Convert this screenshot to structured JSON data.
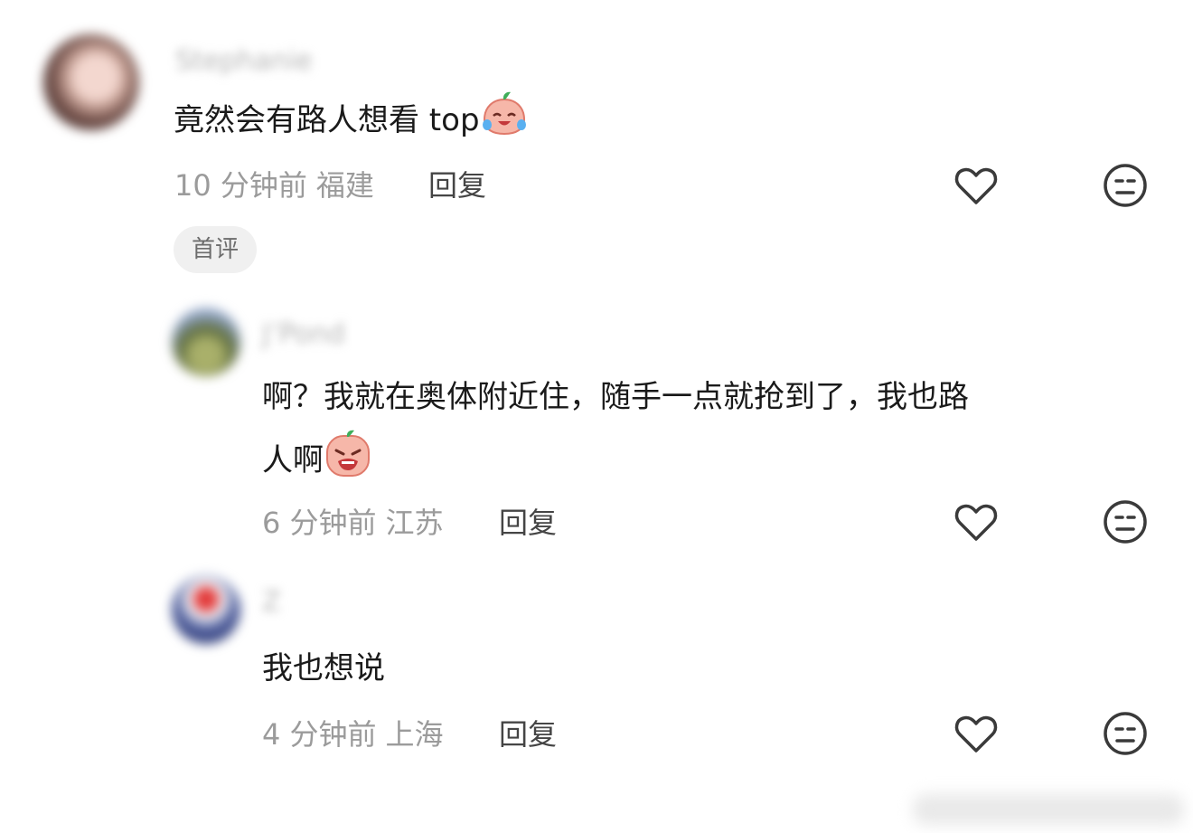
{
  "comments": [
    {
      "username": "Stephanie",
      "text": "竟然会有路人想看 top",
      "emoji": "crying-laughing-emoji",
      "time": "10 分钟前",
      "location": "福建",
      "reply_label": "回复",
      "badge": "首评"
    },
    {
      "username": "J’Pond",
      "text_line1": "啊？我就在奥体附近住，随手一点就抢到了，我也路",
      "text_line2": "人啊",
      "emoji": "sobbing-emoji",
      "time": "6 分钟前",
      "location": "江苏",
      "reply_label": "回复"
    },
    {
      "username": "Z",
      "text": "我也想说",
      "time": "4 分钟前",
      "location": "上海",
      "reply_label": "回复"
    }
  ],
  "icons": {
    "like": "heart-icon",
    "dislike": "meh-face-icon"
  },
  "colors": {
    "text": "#1a1a1a",
    "meta": "#9b9b9b",
    "icon": "#3a3a3a",
    "badge_bg": "#f0f0f0"
  }
}
